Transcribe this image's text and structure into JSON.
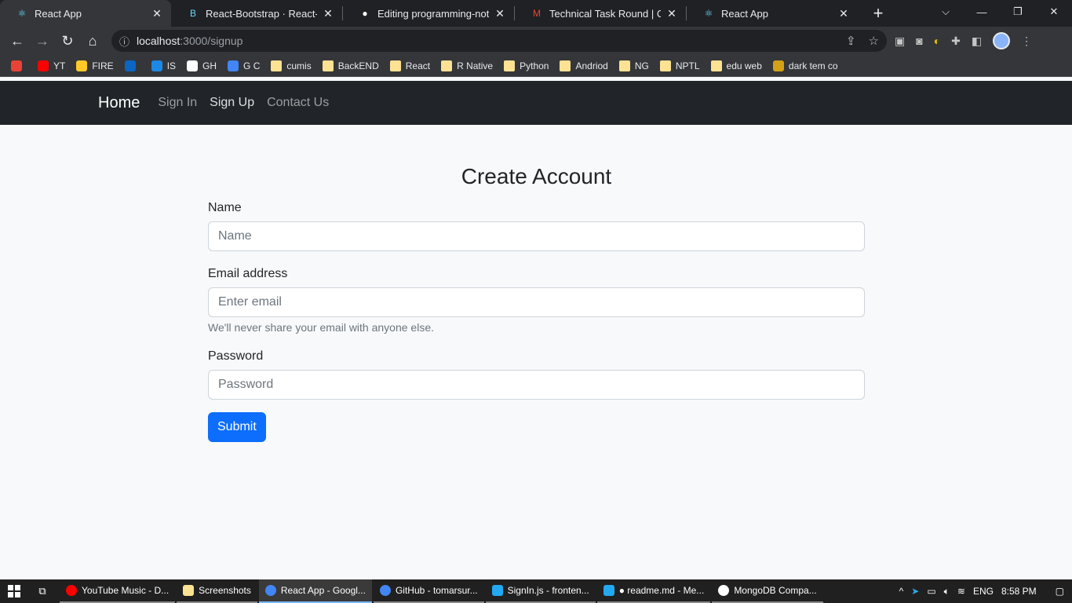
{
  "browser": {
    "tabs": [
      {
        "title": "React App",
        "icon": "react-icon",
        "active": true
      },
      {
        "title": "React-Bootstrap · React-Boot",
        "icon": "bootstrap-icon",
        "active": false
      },
      {
        "title": "Editing programming-notes/",
        "icon": "github-icon",
        "active": false
      },
      {
        "title": "Technical Task Round | Chanc",
        "icon": "gmail-icon",
        "active": false
      },
      {
        "title": "React App",
        "icon": "react-icon",
        "active": false
      }
    ],
    "new_tab": "+",
    "address": {
      "host": "localhost",
      "path": ":3000/signup"
    }
  },
  "bookmarks": [
    {
      "label": "",
      "icon": "gmail-icon",
      "color": "#ea4335"
    },
    {
      "label": "YT",
      "icon": "youtube-icon",
      "color": "#ff0000"
    },
    {
      "label": "FIRE",
      "icon": "firebase-icon",
      "color": "#ffca28"
    },
    {
      "label": "",
      "icon": "linkedin-icon",
      "color": "#0a66c2"
    },
    {
      "label": "IS",
      "icon": "is-icon",
      "color": "#1e88e5"
    },
    {
      "label": "GH",
      "icon": "github-icon",
      "color": "#ffffff"
    },
    {
      "label": "G C",
      "icon": "calendar-icon",
      "color": "#4285f4"
    },
    {
      "label": "cumis",
      "icon": "folder-icon",
      "color": "#fde293"
    },
    {
      "label": "BackEND",
      "icon": "folder-icon",
      "color": "#fde293"
    },
    {
      "label": "React",
      "icon": "folder-icon",
      "color": "#fde293"
    },
    {
      "label": "R Native",
      "icon": "folder-icon",
      "color": "#fde293"
    },
    {
      "label": "Python",
      "icon": "folder-icon",
      "color": "#fde293"
    },
    {
      "label": "Andriod",
      "icon": "folder-icon",
      "color": "#fde293"
    },
    {
      "label": "NG",
      "icon": "folder-icon",
      "color": "#fde293"
    },
    {
      "label": "NPTL",
      "icon": "folder-icon",
      "color": "#fde293"
    },
    {
      "label": "edu web",
      "icon": "folder-icon",
      "color": "#fde293"
    },
    {
      "label": "dark tem co",
      "icon": "theme-icon",
      "color": "#d4a017"
    }
  ],
  "app": {
    "nav": {
      "brand": "Home",
      "links": [
        {
          "label": "Sign In",
          "active": false
        },
        {
          "label": "Sign Up",
          "active": true
        },
        {
          "label": "Contact Us",
          "active": false
        }
      ]
    },
    "form": {
      "title": "Create Account",
      "name_label": "Name",
      "name_placeholder": "Name",
      "email_label": "Email address",
      "email_placeholder": "Enter email",
      "email_help": "We'll never share your email with anyone else.",
      "password_label": "Password",
      "password_placeholder": "Password",
      "submit_label": "Submit"
    }
  },
  "taskbar": {
    "apps": [
      {
        "label": "YouTube Music - D...",
        "icon": "youtube-music-icon",
        "color": "#ff0000",
        "active": false
      },
      {
        "label": "Screenshots",
        "icon": "folder-icon",
        "color": "#fde293",
        "active": false
      },
      {
        "label": "React App - Googl...",
        "icon": "chrome-icon",
        "color": "#4285f4",
        "active": true
      },
      {
        "label": "GitHub - tomarsur...",
        "icon": "chrome-icon",
        "color": "#4285f4",
        "active": false
      },
      {
        "label": "SignIn.js - fronten...",
        "icon": "vscode-icon",
        "color": "#23a9f2",
        "active": false
      },
      {
        "label": "● readme.md - Me...",
        "icon": "vscode-icon",
        "color": "#23a9f2",
        "active": false
      },
      {
        "label": "MongoDB Compa...",
        "icon": "mongodb-icon",
        "color": "#ffffff",
        "active": false
      }
    ],
    "language": "ENG",
    "time": "8:58 PM"
  }
}
